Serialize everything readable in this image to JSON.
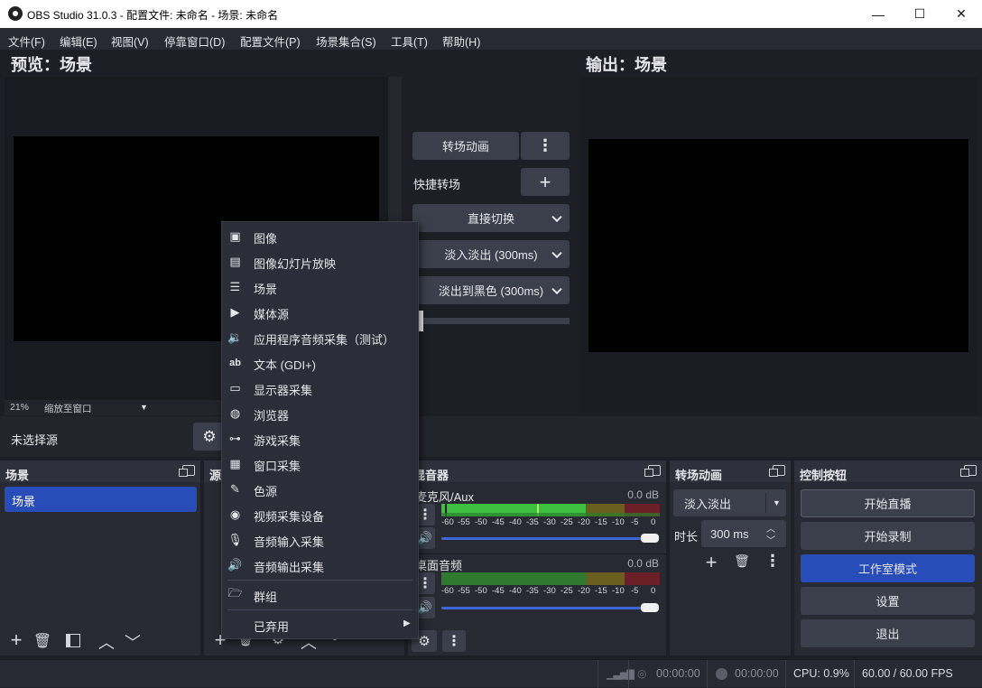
{
  "window": {
    "title": "OBS Studio 31.0.3 - 配置文件: 未命名 - 场景: 未命名",
    "minimize": "—",
    "maximize": "☐",
    "close": "✕"
  },
  "menu": [
    "文件(F)",
    "编辑(E)",
    "视图(V)",
    "停靠窗口(D)",
    "配置文件(P)",
    "场景集合(S)",
    "工具(T)",
    "帮助(H)"
  ],
  "preview": {
    "label": "预览：场景",
    "zoom": "21%",
    "zoom_mode": "缩放至窗口"
  },
  "output": {
    "label": "输出：场景"
  },
  "transition_controls": {
    "transition_button": "转场动画",
    "quick_transition_label": "快捷转场",
    "cut": "直接切换",
    "fade": "淡入淡出 (300ms)",
    "fade_to_black": "淡出到黑色 (300ms)",
    "tbar_value": 0.0
  },
  "source_bar": {
    "no_source": "未选择源"
  },
  "context_menu": {
    "items": [
      {
        "icon": "image-icon",
        "label": "图像"
      },
      {
        "icon": "slideshow-icon",
        "label": "图像幻灯片放映"
      },
      {
        "icon": "list-icon",
        "label": "场景"
      },
      {
        "icon": "play-icon",
        "label": "媒体源"
      },
      {
        "icon": "app-audio-icon",
        "label": "应用程序音频采集（测试）"
      },
      {
        "icon": "text-icon",
        "label": "文本 (GDI+)"
      },
      {
        "icon": "monitor-icon",
        "label": "显示器采集"
      },
      {
        "icon": "globe-icon",
        "label": "浏览器"
      },
      {
        "icon": "gamepad-icon",
        "label": "游戏采集"
      },
      {
        "icon": "window-icon",
        "label": "窗口采集"
      },
      {
        "icon": "brush-icon",
        "label": "色源"
      },
      {
        "icon": "camera-icon",
        "label": "视频采集设备"
      },
      {
        "icon": "microphone-icon",
        "label": "音频输入采集"
      },
      {
        "icon": "speaker-icon",
        "label": "音频输出采集"
      }
    ],
    "group": {
      "icon": "folder-icon",
      "label": "群组"
    },
    "deprecated": {
      "label": "已弃用",
      "arrow": "▶"
    }
  },
  "scenes_dock": {
    "title": "场景",
    "items": [
      "场景"
    ]
  },
  "sources_dock": {
    "title": "源"
  },
  "mixer_dock": {
    "title": "混音器",
    "scale": [
      "-60",
      "-55",
      "-50",
      "-45",
      "-40",
      "-35",
      "-30",
      "-25",
      "-20",
      "-15",
      "-10",
      "-5",
      "0"
    ],
    "channels": [
      {
        "name": "麦克风/Aux",
        "level": "0.0 dB",
        "volume": 1.0
      },
      {
        "name": "桌面音频",
        "level": "0.0 dB",
        "volume": 1.0
      }
    ]
  },
  "transitions_dock": {
    "title": "转场动画",
    "selected": "淡入淡出",
    "duration_label": "时长",
    "duration_value": "300 ms"
  },
  "controls_dock": {
    "title": "控制按钮",
    "start_streaming": "开始直播",
    "start_recording": "开始录制",
    "studio_mode": "工作室模式",
    "settings": "设置",
    "exit": "退出"
  },
  "status": {
    "stream_time": "00:00:00",
    "record_time": "00:00:00",
    "cpu": "CPU: 0.9%",
    "fps": "60.00 / 60.00 FPS"
  },
  "colors": {
    "accent": "#284cb8",
    "meter_green": "#3fbf3f",
    "meter_yellow": "#c8a82c",
    "meter_red": "#c03a3a"
  }
}
